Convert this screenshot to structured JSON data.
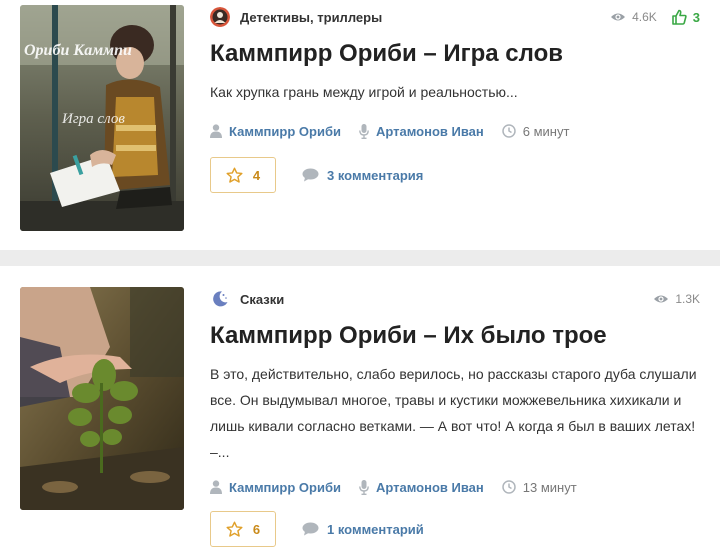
{
  "posts": [
    {
      "category": "Детективы, триллеры",
      "category_icon": "dark-avatar-icon",
      "views": "4.6K",
      "likes": "3",
      "title": "Каммпирр Ориби – Игра слов",
      "excerpt": "Как хрупка грань между игрой и реальностью...",
      "author": "Каммпирр Ориби",
      "narrator": "Артамонов Иван",
      "duration": "6 минут",
      "rating": "4",
      "comments": "3 комментария",
      "thumb_overlay_top": "Ориби Каммпи",
      "thumb_overlay_bottom": "Игра слов"
    },
    {
      "category": "Сказки",
      "category_icon": "moon-icon",
      "views": "1.3K",
      "title": "Каммпирр Ориби – Их было трое",
      "excerpt": "В это, действительно, слабо верилось, но рассказы старого дуба слушали все. Он выдумывал многое, травы и кустики можжевельника хихикали и лишь кивали согласно ветками. — А вот что! А когда я был в ваших летах! –...",
      "author": "Каммпирр Ориби",
      "narrator": "Артамонов Иван",
      "duration": "13 минут",
      "rating": "6",
      "comments": "1 комментарий"
    }
  ],
  "colors": {
    "accent_link": "#4a7aa8",
    "like_green": "#3aa845",
    "rating_orange": "#c98a1a",
    "rating_border": "#e8c98a",
    "page_bg": "#ececec"
  }
}
